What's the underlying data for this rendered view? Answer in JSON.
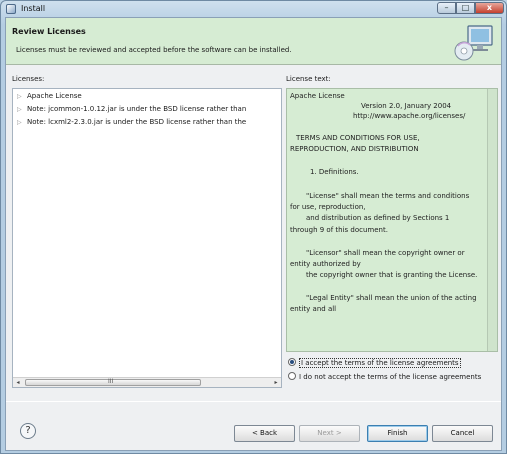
{
  "window": {
    "title": "Install"
  },
  "banner": {
    "title": "Review Licenses",
    "description": "Licenses must be reviewed and accepted before the software can be installed."
  },
  "licenses": {
    "label": "Licenses:",
    "items": [
      "Apache License",
      "Note:  jcommon-1.0.12.jar is under the BSD license rather than",
      "Note:  lcxml2-2.3.0.jar is under the BSD license rather than the"
    ],
    "scroll_grip": "III"
  },
  "license_text": {
    "label": "License text:",
    "lines": [
      "Apache License",
      "Version 2.0, January 2004",
      "http://www.apache.org/licenses/",
      "TERMS AND CONDITIONS FOR USE,",
      "REPRODUCTION, AND DISTRIBUTION",
      "1. Definitions.",
      "\"License\" shall mean the terms and conditions",
      "for use, reproduction,",
      "and distribution as defined by Sections 1",
      "through 9 of this document.",
      "\"Licensor\" shall mean the copyright owner or",
      "entity authorized by",
      "the copyright owner that is granting the License.",
      "\"Legal Entity\" shall mean the union of the acting",
      "entity and all"
    ]
  },
  "agreement": {
    "accept_label": "I accept the terms of the license agreements",
    "decline_label": "I do not accept the terms of the license agreements"
  },
  "buttons": {
    "help": "?",
    "back": "< Back",
    "next": "Next >",
    "finish": "Finish",
    "cancel": "Cancel"
  },
  "window_controls": {
    "minimize": "–",
    "maximize": "□",
    "close": "x"
  }
}
